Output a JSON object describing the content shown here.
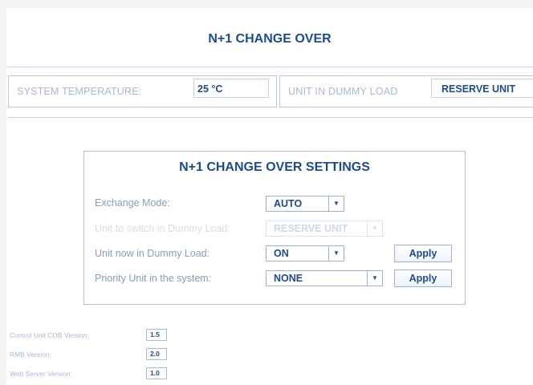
{
  "header": {
    "title": "N+1 CHANGE OVER"
  },
  "status": {
    "temperature_label": "SYSTEM TEMPERATURE:",
    "temperature_value": "25 °C",
    "dummy_load_label": "UNIT IN DUMMY LOAD",
    "dummy_load_value": "RESERVE UNIT"
  },
  "settings": {
    "title": "N+1 CHANGE OVER SETTINGS",
    "exchange_mode_label": "Exchange Mode:",
    "exchange_mode_value": "AUTO",
    "unit_switch_label": "Unit to switch in Dummy Load:",
    "unit_switch_value": "RESERVE UNIT",
    "unit_now_label": "Unit now in Dummy Load:",
    "unit_now_value": "ON",
    "priority_label": "Priority Unit in the system:",
    "priority_value": "NONE",
    "apply_label": "Apply",
    "dropdown_glyph": "▼"
  },
  "versions": {
    "cob_label": "Control Unit COB Version:",
    "cob_value": "1.5",
    "rmb_label": "RMB Version:",
    "rmb_value": "2.0",
    "web_label": "Web Server Version:",
    "web_value": "1.0"
  },
  "colors": {
    "accent": "#1f4b87",
    "label": "#8a9db8",
    "border": "#9fb3ce"
  }
}
